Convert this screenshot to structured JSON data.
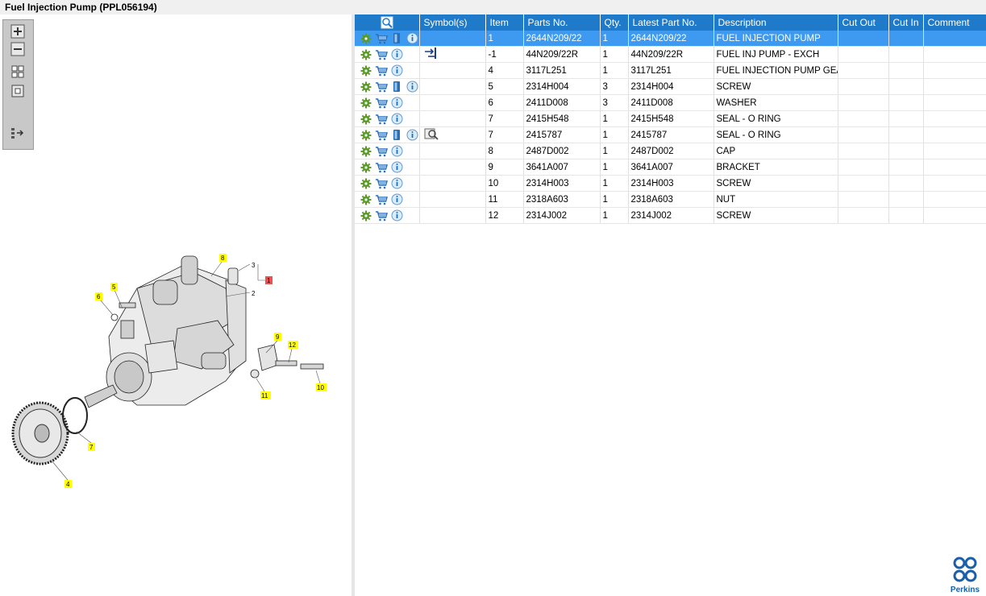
{
  "window": {
    "title": "Fuel Injection Pump (PPL056194)"
  },
  "toolbar": {
    "buttons": [
      {
        "name": "zoom-in-button",
        "icon": "zoom-in-icon"
      },
      {
        "name": "zoom-out-button",
        "icon": "zoom-out-icon"
      },
      {
        "name": "fit-all-button",
        "icon": "grid-icon"
      },
      {
        "name": "fit-box-button",
        "icon": "square-icon"
      },
      {
        "name": "export-button",
        "icon": "export-icon"
      }
    ]
  },
  "diagram": {
    "callouts": [
      "8",
      "3",
      "1",
      "2",
      "5",
      "6",
      "9",
      "12",
      "10",
      "11",
      "7",
      "4"
    ]
  },
  "table": {
    "headers": {
      "icons": "",
      "symbols": "Symbol(s)",
      "item": "Item",
      "parts_no": "Parts No.",
      "qty": "Qty.",
      "latest": "Latest Part No.",
      "description": "Description",
      "cut_out": "Cut Out",
      "cut_in": "Cut In",
      "comment": "Comment"
    },
    "rows": [
      {
        "item": "1",
        "parts_no": "2644N209/22",
        "qty": "1",
        "latest": "2644N209/22",
        "description": "FUEL INJECTION PUMP",
        "selected": true,
        "icons": [
          "gear-icon",
          "cart-icon",
          "book-icon",
          "info-icon"
        ],
        "symbol": ""
      },
      {
        "item": "-1",
        "parts_no": "44N209/22R",
        "qty": "1",
        "latest": "44N209/22R",
        "description": "FUEL INJ PUMP - EXCH",
        "selected": false,
        "icons": [
          "gear-icon",
          "cart-icon",
          "info-icon"
        ],
        "symbol": "exchange-icon"
      },
      {
        "item": "4",
        "parts_no": "3117L251",
        "qty": "1",
        "latest": "3117L251",
        "description": "FUEL INJECTION PUMP GEAR",
        "selected": false,
        "icons": [
          "gear-icon",
          "cart-icon",
          "info-icon"
        ],
        "symbol": ""
      },
      {
        "item": "5",
        "parts_no": "2314H004",
        "qty": "3",
        "latest": "2314H004",
        "description": "SCREW",
        "selected": false,
        "icons": [
          "gear-icon",
          "cart-icon",
          "book-icon",
          "info-icon"
        ],
        "symbol": ""
      },
      {
        "item": "6",
        "parts_no": "2411D008",
        "qty": "3",
        "latest": "2411D008",
        "description": "WASHER",
        "selected": false,
        "icons": [
          "gear-icon",
          "cart-icon",
          "info-icon"
        ],
        "symbol": ""
      },
      {
        "item": "7",
        "parts_no": "2415H548",
        "qty": "1",
        "latest": "2415H548",
        "description": "SEAL - O RING",
        "selected": false,
        "icons": [
          "gear-icon",
          "cart-icon",
          "info-icon"
        ],
        "symbol": ""
      },
      {
        "item": "7",
        "parts_no": "2415787",
        "qty": "1",
        "latest": "2415787",
        "description": "SEAL - O RING",
        "selected": false,
        "icons": [
          "gear-icon",
          "cart-icon",
          "book-icon",
          "info-icon"
        ],
        "symbol": "manual-icon"
      },
      {
        "item": "8",
        "parts_no": "2487D002",
        "qty": "1",
        "latest": "2487D002",
        "description": "CAP",
        "selected": false,
        "icons": [
          "gear-icon",
          "cart-icon",
          "info-icon"
        ],
        "symbol": ""
      },
      {
        "item": "9",
        "parts_no": "3641A007",
        "qty": "1",
        "latest": "3641A007",
        "description": "BRACKET",
        "selected": false,
        "icons": [
          "gear-icon",
          "cart-icon",
          "info-icon"
        ],
        "symbol": ""
      },
      {
        "item": "10",
        "parts_no": "2314H003",
        "qty": "1",
        "latest": "2314H003",
        "description": "SCREW",
        "selected": false,
        "icons": [
          "gear-icon",
          "cart-icon",
          "info-icon"
        ],
        "symbol": ""
      },
      {
        "item": "11",
        "parts_no": "2318A603",
        "qty": "1",
        "latest": "2318A603",
        "description": "NUT",
        "selected": false,
        "icons": [
          "gear-icon",
          "cart-icon",
          "info-icon"
        ],
        "symbol": ""
      },
      {
        "item": "12",
        "parts_no": "2314J002",
        "qty": "1",
        "latest": "2314J002",
        "description": "SCREW",
        "selected": false,
        "icons": [
          "gear-icon",
          "cart-icon",
          "info-icon"
        ],
        "symbol": ""
      }
    ]
  },
  "brand": {
    "name": "Perkins"
  },
  "colors": {
    "header": "#1f7ac9",
    "selected_row": "#3d9af0",
    "callout": "#ffff00",
    "callout_highlight": "#f05050"
  }
}
